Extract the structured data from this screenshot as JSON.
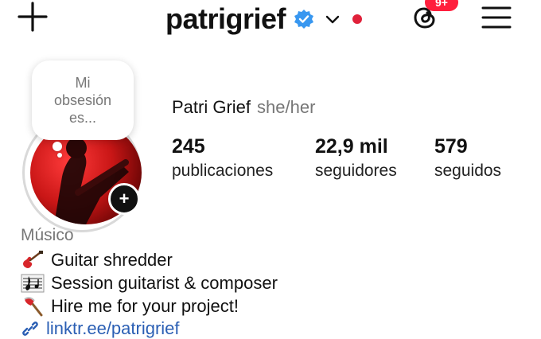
{
  "header": {
    "username": "patrigrief",
    "threads_badge": "9+",
    "icons": [
      "add-icon",
      "verified-icon",
      "chevron-down-icon",
      "notification-dot",
      "threads-icon",
      "menu-icon"
    ],
    "colors": {
      "verified": "#3897f0",
      "notification": "#e0213a"
    }
  },
  "note": {
    "text": "Mi obsesión es..."
  },
  "profile": {
    "display_name": "Patri Grief",
    "pronouns": "she/her",
    "stats": [
      {
        "value": "245",
        "label": "publicaciones"
      },
      {
        "value": "22,9 mil",
        "label": "seguidores"
      },
      {
        "value": "579",
        "label": "seguidos"
      }
    ]
  },
  "bio": {
    "category": "Músico",
    "lines": [
      {
        "icon": "guitar-icon",
        "text": "Guitar shredder"
      },
      {
        "icon": "music-score-icon",
        "text": "Session guitarist & composer"
      },
      {
        "icon": "axe-icon",
        "text": "Hire me for your project!"
      }
    ],
    "link_text": "linktr.ee/patrigrief"
  }
}
